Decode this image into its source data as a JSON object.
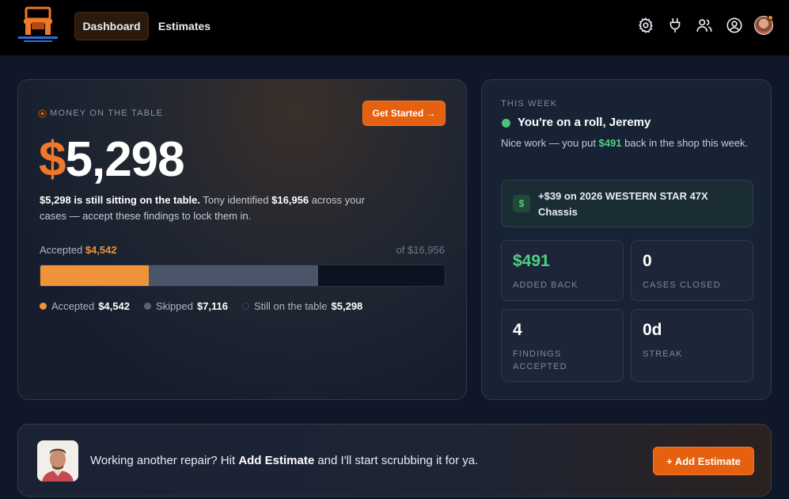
{
  "header": {
    "logo_icon": "truck-chair-logo",
    "nav": [
      {
        "label": "Dashboard",
        "active": true
      },
      {
        "label": "Estimates",
        "active": false
      }
    ],
    "icons": [
      "gear-icon",
      "plug-icon",
      "users-icon",
      "user-circle-icon"
    ],
    "avatar_icon": "user-avatar"
  },
  "money_card": {
    "label": "MONEY ON THE TABLE",
    "cta": "Get Started →",
    "amount_currency": "$",
    "amount_value": "5,298",
    "desc_bold1": "$5,298 is still sitting on the table.",
    "desc_mid1": " Tony identified ",
    "desc_bold2": "$16,956",
    "desc_mid2": " across your cases — accept these findings to lock them in.",
    "accepted_label": "Accepted",
    "accepted_value": "$4,542",
    "of_total": "of $16,956",
    "progress": {
      "total": 16956,
      "accepted": 4542,
      "skipped": 7116,
      "remaining": 5298
    },
    "legend": [
      {
        "label": "Accepted",
        "value": "$4,542",
        "color": "#f0923a"
      },
      {
        "label": "Skipped",
        "value": "$7,116",
        "color": "#5a6377"
      },
      {
        "label": "Still on the table",
        "value": "$5,298",
        "color": "#1b2436"
      }
    ]
  },
  "week_card": {
    "label": "THIS WEEK",
    "title": "You're on a roll, Jeremy",
    "desc_pre": "Nice work — you put ",
    "desc_amount": "$491",
    "desc_post": " back in the shop this week.",
    "gain_icon": "$",
    "gain_text": "+$39 on 2026 WESTERN STAR 47X Chassis",
    "stats": [
      {
        "value": "$491",
        "label": "ADDED BACK"
      },
      {
        "value": "0",
        "label": "CASES CLOSED"
      },
      {
        "value": "4",
        "label": "FINDINGS ACCEPTED"
      },
      {
        "value": "0d",
        "label": "STREAK"
      }
    ]
  },
  "banner": {
    "avatar_icon": "tony-avatar",
    "text_pre": "Working another repair? Hit ",
    "text_bold": "Add Estimate",
    "text_post": " and I'll start scrubbing it for ya.",
    "cta": "+ Add Estimate"
  },
  "colors": {
    "accent": "#e5600f",
    "green": "#4cd184",
    "background": "#0f1728"
  }
}
